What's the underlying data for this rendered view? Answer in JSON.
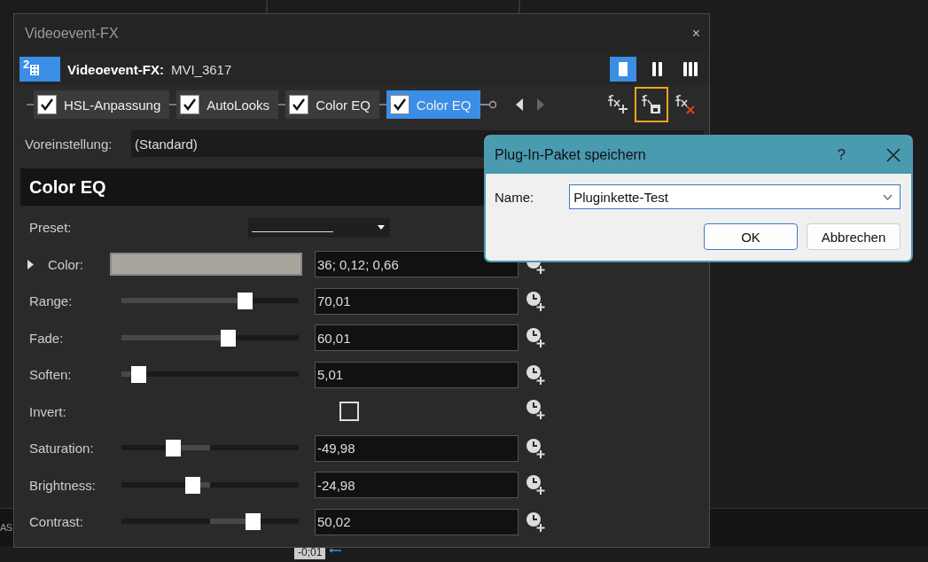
{
  "background": {
    "side_text": "AS",
    "timecode": "-0;01"
  },
  "window": {
    "title": "Videoevent-FX",
    "close": "×"
  },
  "header": {
    "badge": "2",
    "label": "Videoevent-FX:",
    "clip": "MVI_3617",
    "layouts": [
      {
        "selected": true
      },
      {
        "selected": false
      },
      {
        "selected": false
      }
    ]
  },
  "chain": [
    {
      "label": "HSL-Anpassung",
      "checked": true,
      "selected": false
    },
    {
      "label": "AutoLooks",
      "checked": true,
      "selected": false
    },
    {
      "label": "Color EQ",
      "checked": true,
      "selected": false
    },
    {
      "label": "Color EQ",
      "checked": true,
      "selected": true
    }
  ],
  "chain_tools": [
    {
      "kind": "add",
      "highlighted": false
    },
    {
      "kind": "save",
      "highlighted": true
    },
    {
      "kind": "remove",
      "highlighted": false
    }
  ],
  "preset_row": {
    "label": "Voreinstellung:",
    "value": "(Standard)"
  },
  "panel": {
    "title": "Color EQ",
    "preset_label": "Preset:",
    "params": [
      {
        "kind": "color",
        "label": "Color:",
        "color": "#aaa59c",
        "value": "36; 0,12; 0,66"
      },
      {
        "kind": "slider",
        "label": "Range:",
        "level": 0.71,
        "value": "70,01"
      },
      {
        "kind": "slider",
        "label": "Fade:",
        "level": 0.61,
        "value": "60,01"
      },
      {
        "kind": "slider",
        "label": "Soften:",
        "level": 0.06,
        "value": "5,01"
      },
      {
        "kind": "checkbox",
        "label": "Invert:",
        "checked": false
      },
      {
        "kind": "centered",
        "label": "Saturation:",
        "level": 0.27,
        "value": "-49,98"
      },
      {
        "kind": "centered",
        "label": "Brightness:",
        "level": 0.39,
        "value": "-24,98"
      },
      {
        "kind": "centered",
        "label": "Contrast:",
        "level": 0.76,
        "value": "50,02"
      }
    ]
  },
  "dialog": {
    "title": "Plug-In-Paket speichern",
    "help": "?",
    "name_label": "Name:",
    "name_value": "Pluginkette-Test",
    "buttons": [
      {
        "label": "OK",
        "default": true
      },
      {
        "label": "Abbrechen",
        "default": false
      }
    ]
  }
}
